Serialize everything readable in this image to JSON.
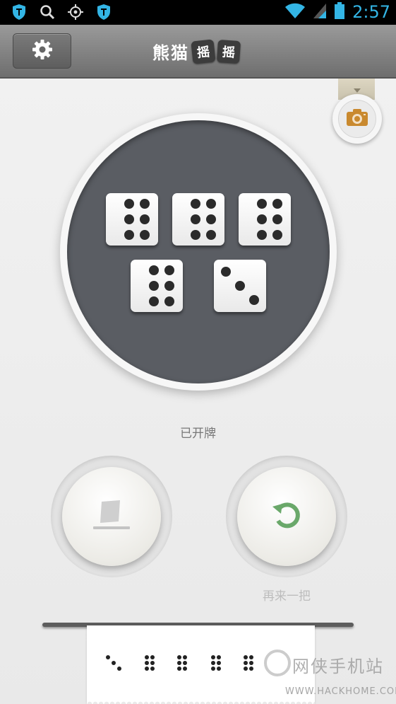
{
  "status_bar": {
    "time": "2:57",
    "icons": [
      "shield-icon",
      "search-icon",
      "location-target-icon",
      "shield-icon",
      "wifi-icon",
      "signal-icon",
      "battery-icon"
    ]
  },
  "action_bar": {
    "title": "熊猫",
    "title_tiles": [
      "摇",
      "摇"
    ],
    "icons": [
      "gear-icon"
    ]
  },
  "camera_icon": "camera-icon",
  "dice": [
    6,
    6,
    6,
    6,
    3
  ],
  "status": "已开牌",
  "buttons": {
    "cover_icon": "cup-cover-icon",
    "again_icon": "refresh-icon",
    "again_label": "再来一把"
  },
  "history_strip": [
    3,
    6,
    6,
    6,
    6
  ],
  "watermark": {
    "title": "网侠手机站",
    "url": "WWW.HACKHOME.COM"
  },
  "colors": {
    "plate": "#5a5d63",
    "accent_green": "#6aa86a",
    "camera_orange": "#c9892e",
    "status_blue": "#33b5e5"
  }
}
